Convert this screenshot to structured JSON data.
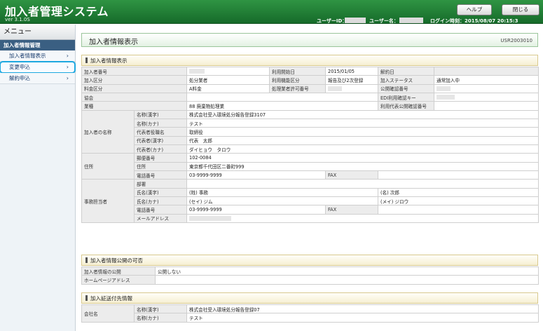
{
  "header": {
    "title": "加入者管理システム",
    "version": "ver  3.1.0S",
    "help_label": "ヘルプ",
    "close_label": "閉じる",
    "user_id_label": "ユーザーID：",
    "user_name_label": "ユーザー名：",
    "login_time": "ログイン時刻：2015/08/07 20:15:3"
  },
  "sidebar": {
    "menu_title": "メニュー",
    "section": "加入者情報管理",
    "items": [
      {
        "label": "加入者情報表示"
      },
      {
        "label": "変更申込"
      },
      {
        "label": "解約申込"
      }
    ]
  },
  "page": {
    "title": "加入者情報表示",
    "screen_code": "USR2003010"
  },
  "sec1": {
    "heading": "加入者情報表示",
    "member_no": "加入者番号",
    "start_date_label": "利用開始日",
    "start_date": "2015/01/05",
    "cancel_date_label": "解約日",
    "member_type_label": "加入区分",
    "member_type": "処分業者",
    "function_label": "利用機能区分",
    "function_value": "報告及び2次登録",
    "status_label": "加入ステータス",
    "status": "通常加入中",
    "fee_label": "料金区分",
    "fee": "A料金",
    "permit_label": "処理業者許可番号",
    "public_no_label": "公開確認番号",
    "assoc_label": "協会",
    "edi_label": "EDI利用確認キー",
    "industry_label": "業種",
    "industry": "88 廃棄物処理業",
    "rep_public_label": "利用代表公開確認番号",
    "name_group": "加入者の名称",
    "name_kanji_label": "名称(漢字)",
    "name_kanji": "株式会社受入環境処分報告登録3107",
    "name_kana_label": "名称(カナ)",
    "name_kana": "テスト",
    "rep_title_label": "代表者役職名",
    "rep_title": "取締役",
    "rep_kanji_label": "代表者(漢字)",
    "rep_kanji": "代表　太郎",
    "rep_kana_label": "代表者(カナ)",
    "rep_kana": "ダイヒョウ　タロウ",
    "address_group": "住所",
    "zip_label": "郵便番号",
    "zip": "102-0084",
    "addr_label": "住所",
    "addr": "東京都千代田区二番町999",
    "tel_label": "電話番号",
    "tel": "03-9999-9999",
    "fax_label": "FAX",
    "office_group": "事務担当者",
    "dept_label": "部署",
    "staff_kanji_label": "氏名(漢字)",
    "staff_last_kanji": "(姓) 事務",
    "staff_first_kanji": "(名) 次郎",
    "staff_kana_label": "氏名(カナ)",
    "staff_last_kana": "(セイ) ジム",
    "staff_first_kana": "(メイ) ジロウ",
    "staff_tel_label": "電話番号",
    "staff_tel": "03-9999-9999",
    "staff_fax_label": "FAX",
    "mail_label": "メールアドレス"
  },
  "sec2": {
    "heading": "加入者情報公開の可否",
    "public_label": "加入者情報の公開",
    "public_value": "公開しない",
    "homepage_label": "ホームページアドレス"
  },
  "sec3": {
    "heading": "加入証送付先情報",
    "company_group": "会社名",
    "name_kanji_label": "名称(漢字)",
    "name_kanji": "株式会社受入環境処分報告登録07",
    "name_kana_label": "名称(カナ)",
    "name_kana": "テスト"
  },
  "colors": {
    "header_green": "#1f7d33",
    "sidebar_section": "#3a5f82",
    "selected_outline": "#1da8e0"
  }
}
